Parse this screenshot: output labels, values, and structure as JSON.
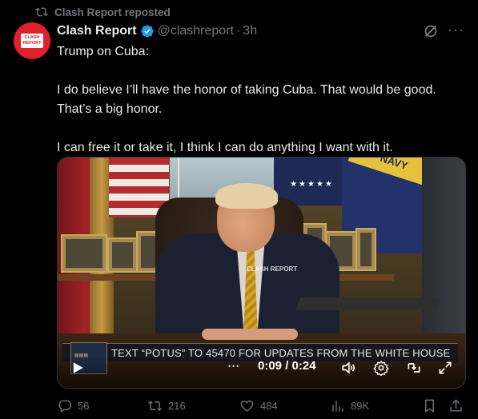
{
  "repost": {
    "label": "Clash Report reposted"
  },
  "author": {
    "name": "Clash Report",
    "handle": "@clashreport",
    "time": "3h",
    "avatar_text": "CLASH REPORT",
    "verified": true
  },
  "tweet": {
    "paragraphs": [
      "Trump on Cuba:",
      "I do believe I’ll have the honor of taking Cuba. That would be good. That’s a big honor.",
      "I can free it or take it, I think I can do anything I want with it."
    ]
  },
  "video": {
    "lower_third": "TEXT “POTUS” TO 45470 FOR UPDATES FROM THE WHITE HOUSE",
    "watermark": "CLASH REPORT",
    "flag_text": "NAVY",
    "time_current": "0:09",
    "time_total": "0:24",
    "time_display": "0:09 / 0:24",
    "progress": 0.375
  },
  "actions": {
    "replies": "56",
    "reposts": "216",
    "likes": "484",
    "views": "89K"
  },
  "colors": {
    "background": "#000000",
    "text": "#e7e9ea",
    "muted": "#71767b",
    "verified": "#1d9bf0",
    "avatar": "#e0202a"
  },
  "icons": [
    "repost-icon",
    "verified-badge-icon",
    "grok-icon",
    "more-icon",
    "play-icon",
    "volume-icon",
    "settings-icon",
    "minimize-icon",
    "fullscreen-icon",
    "reply-icon",
    "like-icon",
    "views-icon",
    "bookmark-icon",
    "share-icon"
  ]
}
